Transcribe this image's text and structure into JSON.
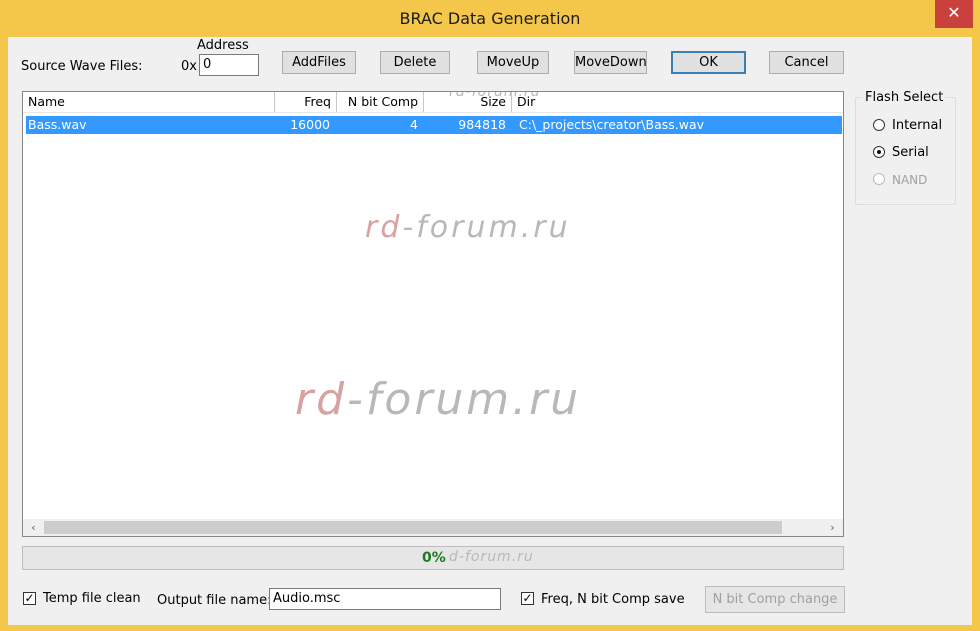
{
  "window": {
    "title": "BRAC Data Generation",
    "close_glyph": "✕"
  },
  "toolbar": {
    "source_label": "Source Wave Files:",
    "address_label": "Address",
    "hex_prefix": "0x",
    "address_value": "0",
    "add_files": "AddFiles",
    "delete": "Delete",
    "move_up": "MoveUp",
    "move_down": "MoveDown",
    "ok": "OK",
    "cancel": "Cancel"
  },
  "file_list": {
    "columns": [
      "Name",
      "Freq",
      "N bit Comp",
      "Size",
      "Dir"
    ],
    "rows": [
      {
        "name": "Bass.wav",
        "freq": "16000",
        "nbit": "4",
        "size": "984818",
        "dir": "C:\\_projects\\creator\\Bass.wav"
      }
    ]
  },
  "flash_select": {
    "title": "Flash Select",
    "options": [
      {
        "label": "Internal",
        "selected": false,
        "enabled": true
      },
      {
        "label": "Serial",
        "selected": true,
        "enabled": true
      },
      {
        "label": "NAND",
        "selected": false,
        "enabled": false
      }
    ]
  },
  "progress": {
    "value_text": "0%",
    "value_color": "#1f7a1f"
  },
  "bottom": {
    "temp_clean_label": "Temp file clean",
    "temp_clean_checked": true,
    "output_label": "Output file name:",
    "output_value": "Audio.msc",
    "freq_save_label": "Freq, N bit Comp save",
    "freq_save_checked": true,
    "nbit_change": "N bit Comp change"
  },
  "watermark": {
    "prefix": "rd",
    "rest": "-forum.ru",
    "text_small": "rd-forum.ru",
    "tail": "d-forum.ru"
  },
  "icons": {
    "scroll_left": "‹",
    "scroll_right": "›",
    "check": "✓"
  }
}
